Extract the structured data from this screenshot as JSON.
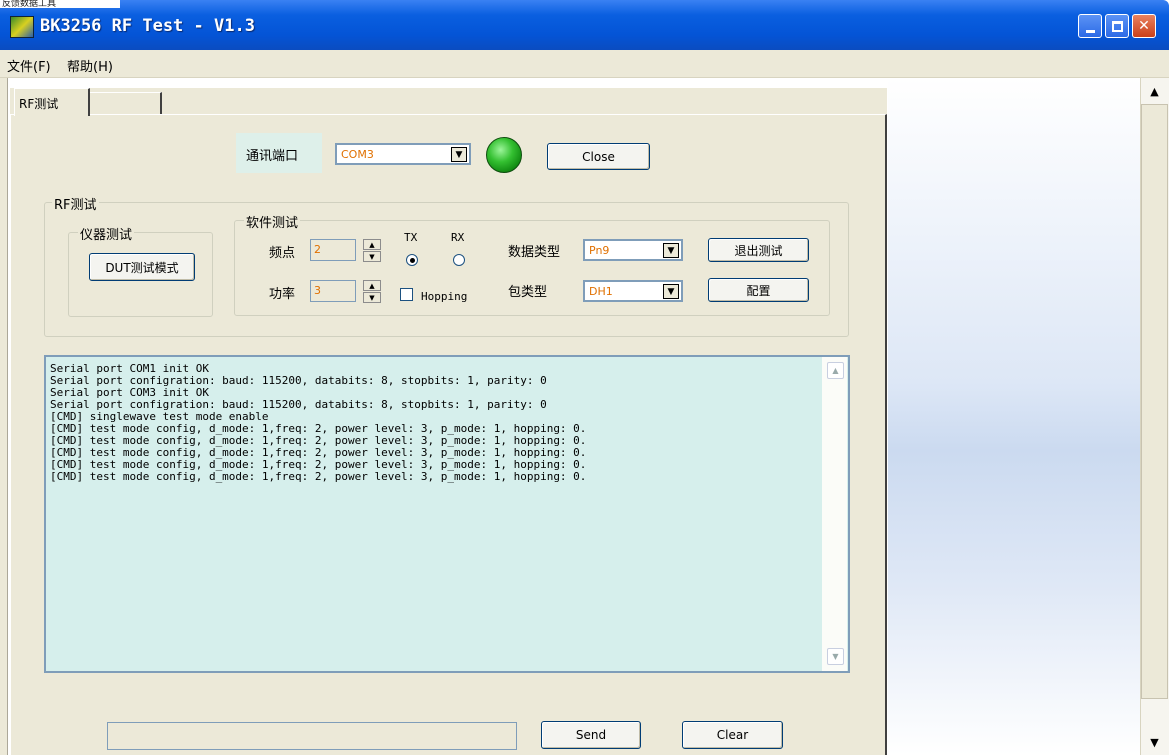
{
  "window": {
    "top_strip_text": "反馈数据工具",
    "title": "BK3256 RF Test - V1.3"
  },
  "menu": {
    "file": "文件(F)",
    "help": "帮助(H)"
  },
  "tabs": [
    {
      "label": "RF测试"
    },
    {
      "label": ""
    }
  ],
  "port": {
    "label": "通讯端口",
    "value": "COM3",
    "close_label": "Close"
  },
  "rf_group": {
    "title": "RF测试",
    "instrument": {
      "title": "仪器测试",
      "dut_button": "DUT测试模式"
    },
    "software": {
      "title": "软件测试",
      "freq_label": "频点",
      "freq_value": "2",
      "power_label": "功率",
      "power_value": "3",
      "tx_label": "TX",
      "rx_label": "RX",
      "hopping_label": "Hopping",
      "data_type_label": "数据类型",
      "data_type_value": "Pn9",
      "packet_type_label": "包类型",
      "packet_type_value": "DH1",
      "exit_button": "退出测试",
      "config_button": "配置"
    }
  },
  "log": {
    "lines": [
      "Serial port COM1 init OK",
      "Serial port configration: baud: 115200, databits: 8, stopbits: 1, parity: 0",
      "Serial port COM3 init OK",
      "Serial port configration: baud: 115200, databits: 8, stopbits: 1, parity: 0",
      "[CMD] singlewave test mode enable",
      "[CMD] test mode config, d_mode: 1,freq: 2, power level: 3, p_mode: 1, hopping: 0.",
      "[CMD] test mode config, d_mode: 1,freq: 2, power level: 3, p_mode: 1, hopping: 0.",
      "[CMD] test mode config, d_mode: 1,freq: 2, power level: 3, p_mode: 1, hopping: 0.",
      "[CMD] test mode config, d_mode: 1,freq: 2, power level: 3, p_mode: 1, hopping: 0.",
      "[CMD] test mode config, d_mode: 1,freq: 2, power level: 3, p_mode: 1, hopping: 0."
    ]
  },
  "bottom": {
    "send_value": "",
    "send_label": "Send",
    "clear_label": "Clear"
  },
  "colors": {
    "titlebar": "#0454d6",
    "panel": "#ece9d8",
    "log_bg": "#d6efec",
    "value_text": "#e07000",
    "led": "#34c031"
  }
}
